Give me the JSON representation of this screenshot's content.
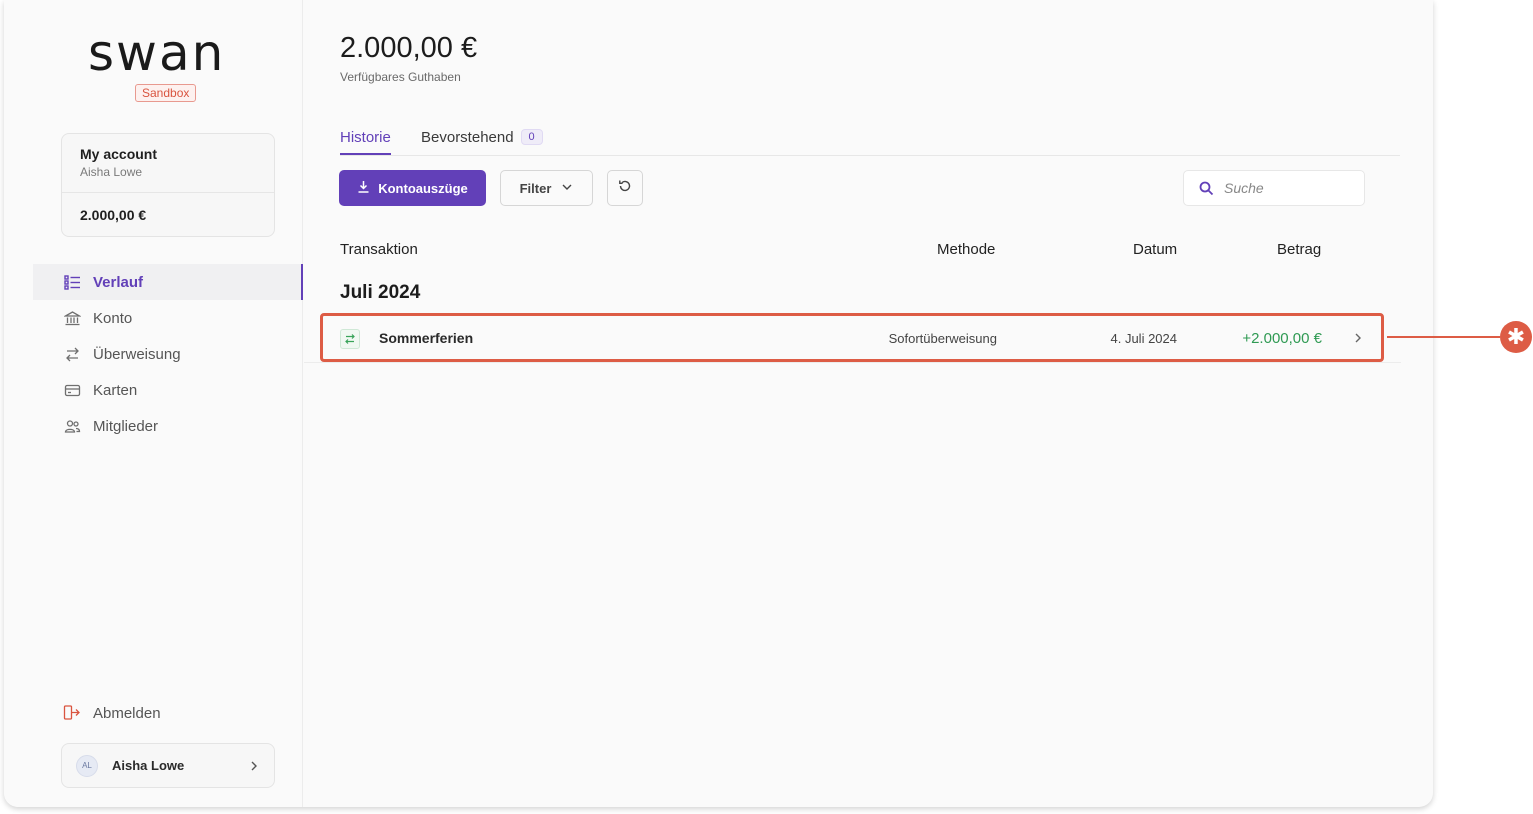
{
  "brand": {
    "logo": "swan",
    "env_badge": "Sandbox"
  },
  "account_card": {
    "name": "My account",
    "holder": "Aisha Lowe",
    "balance": "2.000,00 €"
  },
  "nav": {
    "items": [
      {
        "label": "Verlauf",
        "icon": "list-icon",
        "active": true
      },
      {
        "label": "Konto",
        "icon": "bank-icon",
        "active": false
      },
      {
        "label": "Überweisung",
        "icon": "transfer-icon",
        "active": false
      },
      {
        "label": "Karten",
        "icon": "card-icon",
        "active": false
      },
      {
        "label": "Mitglieder",
        "icon": "members-icon",
        "active": false
      }
    ],
    "logout": "Abmelden"
  },
  "user": {
    "initials": "AL",
    "name": "Aisha Lowe"
  },
  "header": {
    "balance": "2.000,00 €",
    "balance_label": "Verfügbares Guthaben"
  },
  "tabs": [
    {
      "label": "Historie",
      "active": true
    },
    {
      "label": "Bevorstehend",
      "count": "0",
      "active": false
    }
  ],
  "toolbar": {
    "statements_label": "Kontoauszüge",
    "filter_label": "Filter",
    "search_placeholder": "Suche"
  },
  "table": {
    "columns": {
      "transaction": "Transaktion",
      "method": "Methode",
      "date": "Datum",
      "amount": "Betrag"
    },
    "groups": [
      {
        "month": "Juli 2024",
        "rows": [
          {
            "label": "Sommerferien",
            "method": "Sofortüberweisung",
            "date": "4. Juli 2024",
            "amount": "+2.000,00 €"
          }
        ]
      }
    ]
  },
  "annotation": {
    "marker": "✱",
    "color": "#dd5c45"
  },
  "colors": {
    "accent": "#6240b8",
    "positive": "#2f9a53",
    "alert": "#d9543f"
  }
}
